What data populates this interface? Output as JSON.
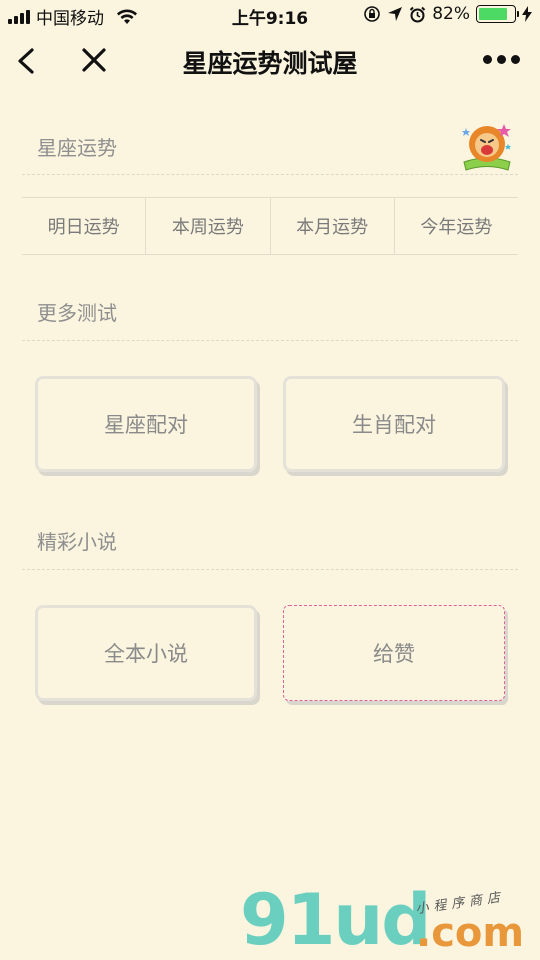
{
  "status_bar": {
    "carrier": "中国移动",
    "time": "上午9:16",
    "battery_percent": "82%",
    "battery_level": 0.82
  },
  "nav": {
    "title": "星座运势测试屋"
  },
  "sections": {
    "horoscope": {
      "title": "星座运势"
    },
    "more_tests": {
      "title": "更多测试"
    },
    "novels": {
      "title": "精彩小说"
    }
  },
  "tabs": [
    {
      "label": "明日运势"
    },
    {
      "label": "本周运势"
    },
    {
      "label": "本月运势"
    },
    {
      "label": "今年运势"
    }
  ],
  "tests": {
    "zodiac_match": "星座配对",
    "chinese_zodiac_match": "生肖配对"
  },
  "novels": {
    "full_novels": "全本小说",
    "like": "给赞"
  },
  "watermark": {
    "brand": "91ud",
    "suffix": ".com",
    "tagline": "小程序商店"
  },
  "colors": {
    "background": "#fbf5e0",
    "battery": "#4cd964",
    "like_border": "#e0609a",
    "watermark_teal": "#6bcfc0",
    "watermark_orange": "#e8973a"
  }
}
